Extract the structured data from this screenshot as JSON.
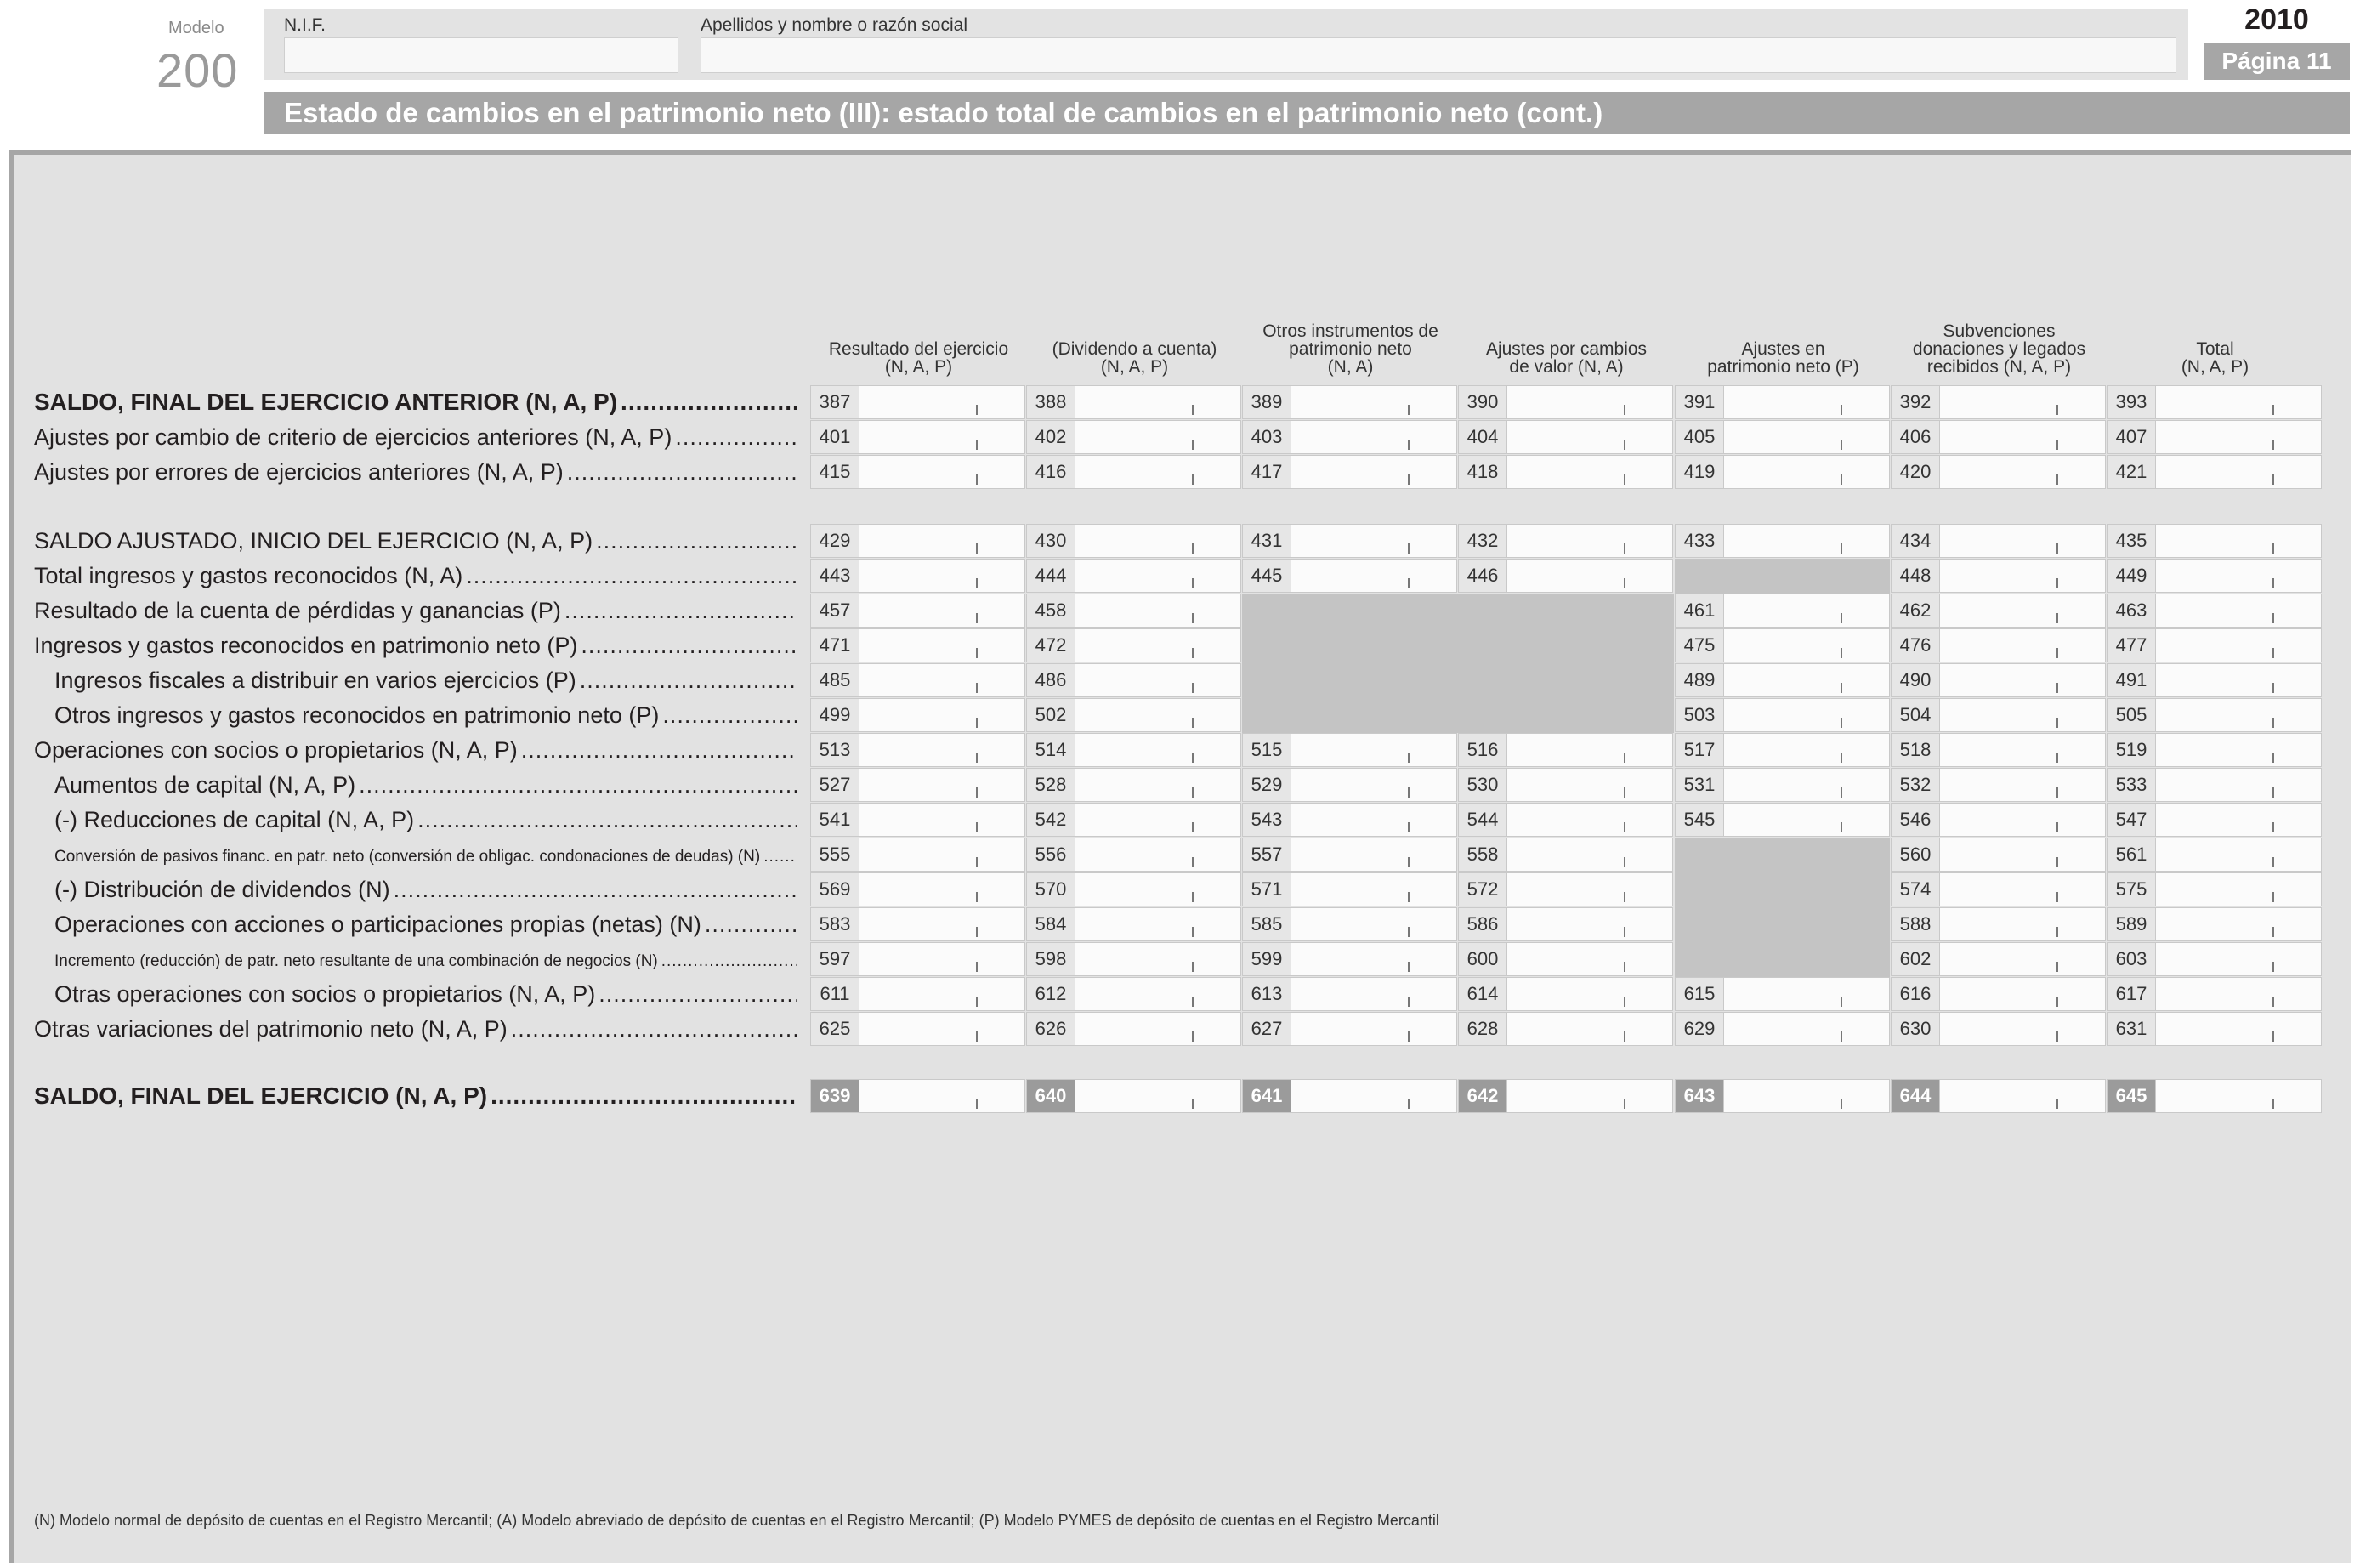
{
  "header": {
    "modelo_label": "Modelo",
    "modelo_number": "200",
    "nif_label": "N.I.F.",
    "nif_value": "",
    "name_label": "Apellidos y nombre o razón social",
    "name_value": "",
    "year": "2010",
    "page": "Página 11",
    "title": "Estado de cambios en el patrimonio neto (III): estado total de cambios en el patrimonio neto (cont.)"
  },
  "columns": [
    {
      "line1": "Resultado del ejercicio",
      "line2": "(N, A, P)",
      "line3": ""
    },
    {
      "line1": "(Dividendo a cuenta)",
      "line2": "(N, A, P)",
      "line3": ""
    },
    {
      "line1": "Otros instrumentos de",
      "line2": "patrimonio neto",
      "line3": "(N, A)"
    },
    {
      "line1": "Ajustes por cambios",
      "line2": "de valor (N, A)",
      "line3": ""
    },
    {
      "line1": "Ajustes en",
      "line2": "patrimonio neto (P)",
      "line3": ""
    },
    {
      "line1": "Subvenciones",
      "line2": "donaciones y legados",
      "line3": "recibidos (N, A, P)"
    },
    {
      "line1": "Total",
      "line2": "(N, A, P)",
      "line3": ""
    }
  ],
  "rows": [
    {
      "label": "SALDO, FINAL DEL EJERCICIO ANTERIOR (N, A, P)",
      "codes": [
        "387",
        "388",
        "389",
        "390",
        "391",
        "392",
        "393"
      ]
    },
    {
      "label": "Ajustes por cambio de criterio de ejercicios anteriores (N, A, P)",
      "codes": [
        "401",
        "402",
        "403",
        "404",
        "405",
        "406",
        "407"
      ]
    },
    {
      "label": "Ajustes por errores de ejercicios anteriores (N, A, P)",
      "codes": [
        "415",
        "416",
        "417",
        "418",
        "419",
        "420",
        "421"
      ]
    },
    {
      "label": "SALDO AJUSTADO, INICIO DEL EJERCICIO (N, A, P)",
      "codes": [
        "429",
        "430",
        "431",
        "432",
        "433",
        "434",
        "435"
      ]
    },
    {
      "label": "Total ingresos y gastos reconocidos (N, A)",
      "codes": [
        "443",
        "444",
        "445",
        "446",
        "",
        "448",
        "449"
      ]
    },
    {
      "label": "Resultado de la cuenta de pérdidas y ganancias (P)",
      "codes": [
        "457",
        "458",
        "",
        "",
        "461",
        "462",
        "463"
      ]
    },
    {
      "label": "Ingresos y gastos reconocidos en patrimonio neto (P)",
      "codes": [
        "471",
        "472",
        "",
        "",
        "475",
        "476",
        "477"
      ]
    },
    {
      "label": "Ingresos fiscales a distribuir en varios ejercicios (P)",
      "codes": [
        "485",
        "486",
        "",
        "",
        "489",
        "490",
        "491"
      ]
    },
    {
      "label": "Otros ingresos y gastos reconocidos en patrimonio neto (P)",
      "codes": [
        "499",
        "502",
        "",
        "",
        "503",
        "504",
        "505"
      ]
    },
    {
      "label": "Operaciones con socios o propietarios (N, A, P)",
      "codes": [
        "513",
        "514",
        "515",
        "516",
        "517",
        "518",
        "519"
      ]
    },
    {
      "label": "Aumentos de capital (N, A, P)",
      "codes": [
        "527",
        "528",
        "529",
        "530",
        "531",
        "532",
        "533"
      ]
    },
    {
      "label": "(-) Reducciones de capital (N, A, P)",
      "codes": [
        "541",
        "542",
        "543",
        "544",
        "545",
        "546",
        "547"
      ]
    },
    {
      "label": "Conversión de pasivos financ. en patr. neto (conversión de obligac. condonaciones de deudas) (N)",
      "codes": [
        "555",
        "556",
        "557",
        "558",
        "",
        "560",
        "561"
      ]
    },
    {
      "label": "(-) Distribución de dividendos (N)",
      "codes": [
        "569",
        "570",
        "571",
        "572",
        "",
        "574",
        "575"
      ]
    },
    {
      "label": "Operaciones con acciones o participaciones propias (netas) (N)",
      "codes": [
        "583",
        "584",
        "585",
        "586",
        "",
        "588",
        "589"
      ]
    },
    {
      "label": "Incremento (reducción) de patr. neto resultante de una combinación de negocios (N)",
      "codes": [
        "597",
        "598",
        "599",
        "600",
        "",
        "602",
        "603"
      ]
    },
    {
      "label": "Otras operaciones con socios o propietarios (N, A, P)",
      "codes": [
        "611",
        "612",
        "613",
        "614",
        "615",
        "616",
        "617"
      ]
    },
    {
      "label": "Otras variaciones del patrimonio neto (N, A, P)",
      "codes": [
        "625",
        "626",
        "627",
        "628",
        "629",
        "630",
        "631"
      ]
    },
    {
      "label": "SALDO, FINAL DEL EJERCICIO (N, A, P)",
      "codes": [
        "639",
        "640",
        "641",
        "642",
        "643",
        "644",
        "645"
      ]
    }
  ],
  "footnote": "(N)   Modelo normal de depósito de cuentas en el Registro Mercantil; (A) Modelo abreviado de depósito de cuentas en el Registro Mercantil; (P) Modelo PYMES de depósito de cuentas en el Registro Mercantil"
}
